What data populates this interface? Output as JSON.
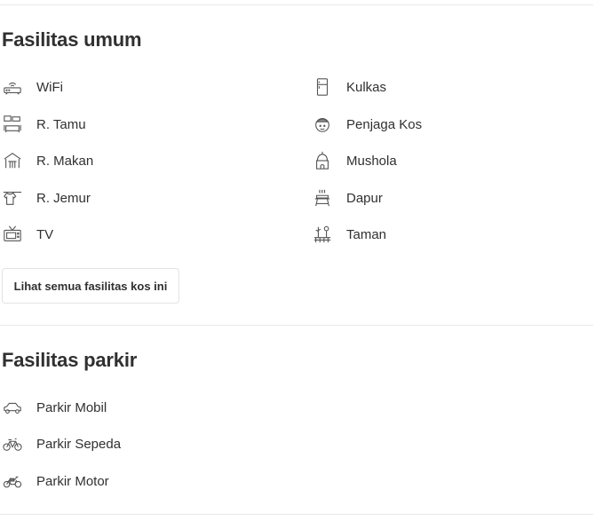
{
  "general": {
    "title": "Fasilitas umum",
    "left": [
      {
        "label": "WiFi",
        "icon": "wifi-router-icon"
      },
      {
        "label": "R. Tamu",
        "icon": "living-room-icon"
      },
      {
        "label": "R. Makan",
        "icon": "dining-room-icon"
      },
      {
        "label": "R. Jemur",
        "icon": "clothesline-icon"
      },
      {
        "label": "TV",
        "icon": "tv-icon"
      }
    ],
    "right": [
      {
        "label": "Kulkas",
        "icon": "fridge-icon"
      },
      {
        "label": "Penjaga Kos",
        "icon": "guard-icon"
      },
      {
        "label": "Mushola",
        "icon": "mosque-icon"
      },
      {
        "label": "Dapur",
        "icon": "kitchen-icon"
      },
      {
        "label": "Taman",
        "icon": "garden-icon"
      }
    ],
    "see_all_label": "Lihat semua fasilitas kos ini"
  },
  "parking": {
    "title": "Fasilitas parkir",
    "items": [
      {
        "label": "Parkir Mobil",
        "icon": "car-icon"
      },
      {
        "label": "Parkir Sepeda",
        "icon": "bicycle-icon"
      },
      {
        "label": "Parkir Motor",
        "icon": "motorcycle-icon"
      }
    ]
  }
}
